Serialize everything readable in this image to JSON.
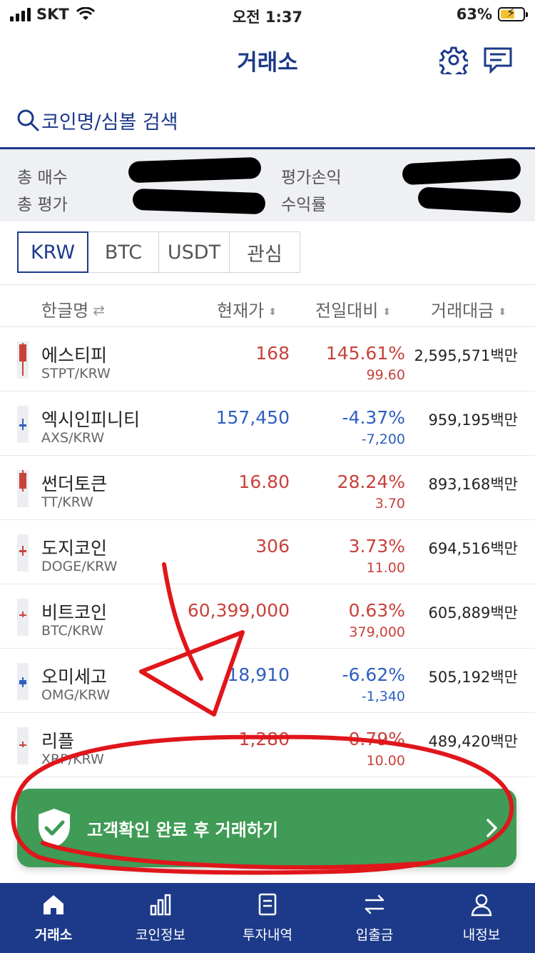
{
  "status": {
    "carrier": "SKT",
    "time": "오전 1:37",
    "battery": "63%",
    "battery_level": 0.63
  },
  "header": {
    "title": "거래소",
    "icons": [
      "gear-icon",
      "chat-icon"
    ]
  },
  "search": {
    "placeholder": "코인명/심볼 검색"
  },
  "summary": {
    "total_buy": "총 매수",
    "total_eval": "총 평가",
    "eval_pl": "평가손익",
    "yield": "수익률"
  },
  "tabs": [
    {
      "label": "KRW",
      "active": true
    },
    {
      "label": "BTC",
      "active": false
    },
    {
      "label": "USDT",
      "active": false
    },
    {
      "label": "관심",
      "active": false
    }
  ],
  "columns": {
    "name": "한글명",
    "price": "현재가",
    "change": "전일대비",
    "volume": "거래대금"
  },
  "coins": [
    {
      "name": "에스티피",
      "symbol": "STPT/KRW",
      "price": "168",
      "pct": "145.61%",
      "chg": "99.60",
      "volume": "2,595,571백만",
      "dir": "up"
    },
    {
      "name": "엑시인피니티",
      "symbol": "AXS/KRW",
      "price": "157,450",
      "pct": "-4.37%",
      "chg": "-7,200",
      "volume": "959,195백만",
      "dir": "down"
    },
    {
      "name": "썬더토큰",
      "symbol": "TT/KRW",
      "price": "16.80",
      "pct": "28.24%",
      "chg": "3.70",
      "volume": "893,168백만",
      "dir": "up"
    },
    {
      "name": "도지코인",
      "symbol": "DOGE/KRW",
      "price": "306",
      "pct": "3.73%",
      "chg": "11.00",
      "volume": "694,516백만",
      "dir": "up"
    },
    {
      "name": "비트코인",
      "symbol": "BTC/KRW",
      "price": "60,399,000",
      "pct": "0.63%",
      "chg": "379,000",
      "volume": "605,889백만",
      "dir": "up"
    },
    {
      "name": "오미세고",
      "symbol": "OMG/KRW",
      "price": "18,910",
      "pct": "-6.62%",
      "chg": "-1,340",
      "volume": "505,192백만",
      "dir": "down"
    },
    {
      "name": "리플",
      "symbol": "XRP/KRW",
      "price": "1,280",
      "pct": "0.79%",
      "chg": "10.00",
      "volume": "489,420백만",
      "dir": "up"
    }
  ],
  "cta": {
    "label": "고객확인 완료 후 거래하기",
    "color": "#3f9b55"
  },
  "tabbar": [
    {
      "label": "거래소",
      "icon": "home-icon",
      "active": true
    },
    {
      "label": "코인정보",
      "icon": "bar-chart-icon",
      "active": false
    },
    {
      "label": "투자내역",
      "icon": "document-icon",
      "active": false
    },
    {
      "label": "입출금",
      "icon": "transfer-icon",
      "active": false
    },
    {
      "label": "내정보",
      "icon": "person-icon",
      "active": false
    }
  ],
  "colors": {
    "primary": "#1d3a8a",
    "up": "#c8423c",
    "down": "#2e5fbf",
    "annotation": "#e0161b"
  }
}
